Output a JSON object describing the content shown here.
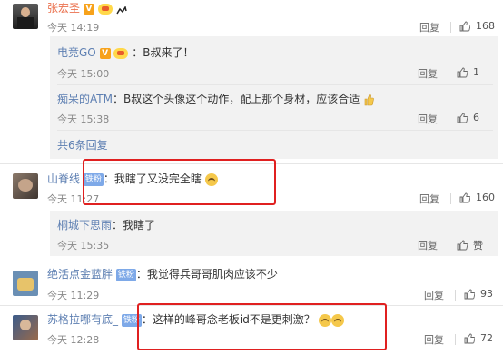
{
  "comments": [
    {
      "user": "张宏圣",
      "text": "",
      "time": "今天 14:19",
      "reply": "回复",
      "likes": "168",
      "replies": [
        {
          "user": "电竞GO",
          "text": "：B叔来了！",
          "time": "今天 15:00",
          "reply": "回复",
          "likes": "1"
        },
        {
          "user": "痴呆的ATM",
          "text": "：B叔这个头像这个动作，配上那个身材，应该合适",
          "time": "今天 15:38",
          "reply": "回复",
          "likes": "6"
        }
      ],
      "more": "共6条回复"
    },
    {
      "user": "山脊线",
      "badge": "铁粉",
      "text": "：我瞎了又没完全瞎",
      "time": "今天 11:27",
      "reply": "回复",
      "likes": "160",
      "replies": [
        {
          "user": "桐城下思雨",
          "text": "：我瞎了",
          "time": "今天 15:35",
          "reply": "回复",
          "likes": "赞"
        }
      ]
    },
    {
      "user": "绝活点金蓝胖",
      "badge": "铁粉",
      "text": "：我觉得兵哥哥肌肉应该不少",
      "time": "今天 11:29",
      "reply": "回复",
      "likes": "93"
    },
    {
      "user": "苏格拉哪有底_",
      "badge": "铁粉",
      "text": "：这样的峰哥念老板id不是更刺激？",
      "time": "今天 12:28",
      "reply": "回复",
      "likes": "72"
    }
  ]
}
